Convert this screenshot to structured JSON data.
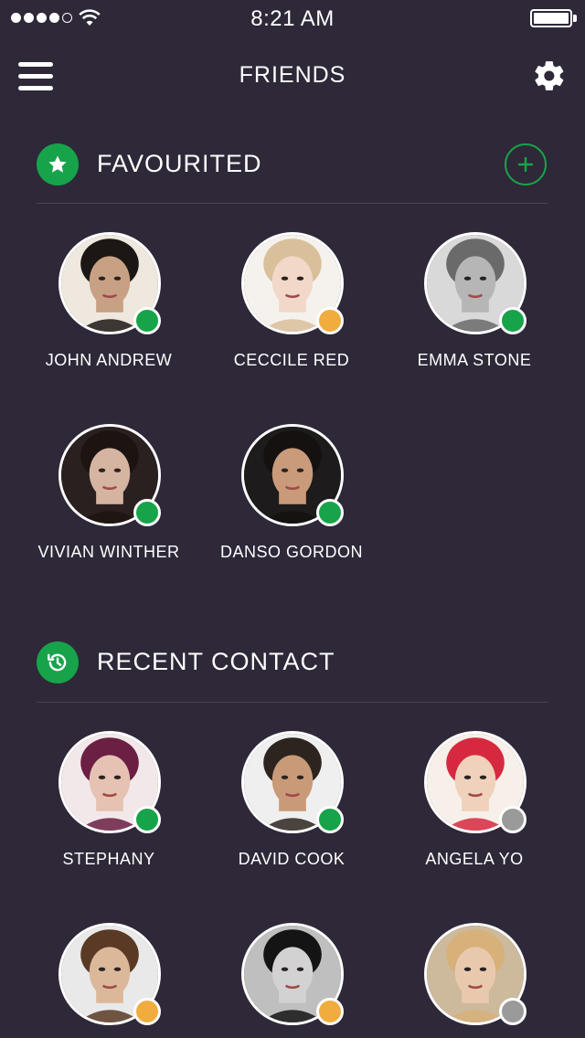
{
  "status_bar": {
    "time": "8:21 AM",
    "signal_dots_filled": 4,
    "signal_dots_total": 5
  },
  "nav": {
    "title": "FRIENDS",
    "menu_icon": "hamburger-menu-icon",
    "settings_icon": "gear-icon"
  },
  "colors": {
    "background": "#2e2838",
    "accent": "#17a34a",
    "status_online": "#17a34a",
    "status_away": "#f0ad3e",
    "status_offline": "#9a9a9a"
  },
  "favourited": {
    "title": "FAVOURITED",
    "icon": "star-icon",
    "add_icon": "plus-icon",
    "contacts": [
      {
        "name": "JOHN ANDREW",
        "status": "online",
        "skin": "#c8a184",
        "hair": "#1c1714",
        "bg": "#efe8de"
      },
      {
        "name": "CECCILE RED",
        "status": "away",
        "skin": "#f1d8c8",
        "hair": "#d9c09a",
        "bg": "#f5f2ee"
      },
      {
        "name": "EMMA STONE",
        "status": "online",
        "skin": "#b6b6b6",
        "hair": "#6a6a6a",
        "bg": "#d9d9d9"
      },
      {
        "name": "VIVIAN WINTHER",
        "status": "online",
        "skin": "#d6b4a2",
        "hair": "#1d1412",
        "bg": "#2a2020"
      },
      {
        "name": "DANSO GORDON",
        "status": "online",
        "skin": "#c99b7a",
        "hair": "#151111",
        "bg": "#1d1b1b"
      }
    ]
  },
  "recent": {
    "title": "RECENT CONTACT",
    "icon": "history-icon",
    "contacts": [
      {
        "name": "STEPHANY",
        "status": "online",
        "skin": "#e6c2b2",
        "hair": "#6b1f43",
        "bg": "#f2e8ea"
      },
      {
        "name": "DAVID COOK",
        "status": "online",
        "skin": "#c99a78",
        "hair": "#2d241f",
        "bg": "#efefef"
      },
      {
        "name": "ANGELA YO",
        "status": "offline",
        "skin": "#f0d1bb",
        "hair": "#d6293f",
        "bg": "#f7efe9"
      },
      {
        "name": "",
        "status": "away",
        "skin": "#dcb89b",
        "hair": "#5a3a24",
        "bg": "#e9e9e9"
      },
      {
        "name": "",
        "status": "away",
        "skin": "#d2d2d2",
        "hair": "#141414",
        "bg": "#bfbfbf"
      },
      {
        "name": "",
        "status": "offline",
        "skin": "#e9c9ad",
        "hair": "#d7b07a",
        "bg": "#cdb99c"
      }
    ]
  }
}
